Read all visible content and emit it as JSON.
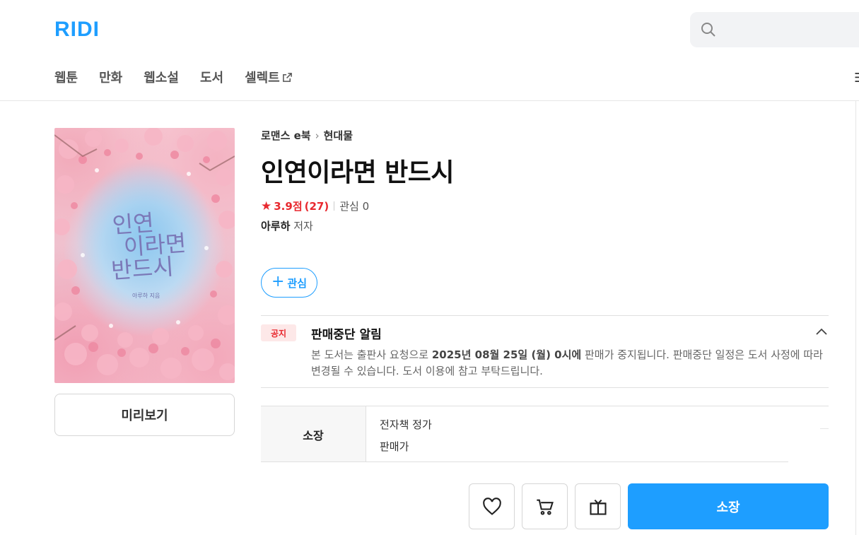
{
  "header": {
    "logo": "RIDI",
    "nav": [
      {
        "label": "웹툰"
      },
      {
        "label": "만화"
      },
      {
        "label": "웹소설"
      },
      {
        "label": "도서"
      },
      {
        "label": "셀렉트"
      }
    ]
  },
  "book": {
    "breadcrumb": [
      "로맨스 e북",
      "현대물"
    ],
    "title": "인연이라면 반드시",
    "rating": {
      "score": "3.9점",
      "count": "(27)",
      "favorites": "관심 0"
    },
    "author": {
      "name": "아루하",
      "role": "저자"
    },
    "cover": {
      "title_lines": [
        "인연",
        "이라면",
        "반드시"
      ],
      "author": "아루하 지음"
    },
    "preview_label": "미리보기",
    "follow_label": "관심"
  },
  "notice": {
    "badge": "공지",
    "title": "판매중단 알림",
    "body_prefix": "본 도서는 출판사 요청으로 ",
    "body_highlight": "2025년 08월 25일 (월) 0시에",
    "body_suffix": " 판매가 중지됩니다. 판매중단 일정은 도서 사정에 따라 변경될 수 있습니다. 도서 이용에 참고 부탁드립니다."
  },
  "price": {
    "type_label": "소장",
    "list_price_label": "전자책 정가",
    "sale_price_label": "판매가"
  },
  "actions": {
    "wishlist_icon": "heart-icon",
    "cart_icon": "cart-icon",
    "gift_icon": "gift-icon",
    "buy_label": "소장"
  },
  "colors": {
    "brand": "#1e9eff",
    "rating": "#e8292f"
  }
}
